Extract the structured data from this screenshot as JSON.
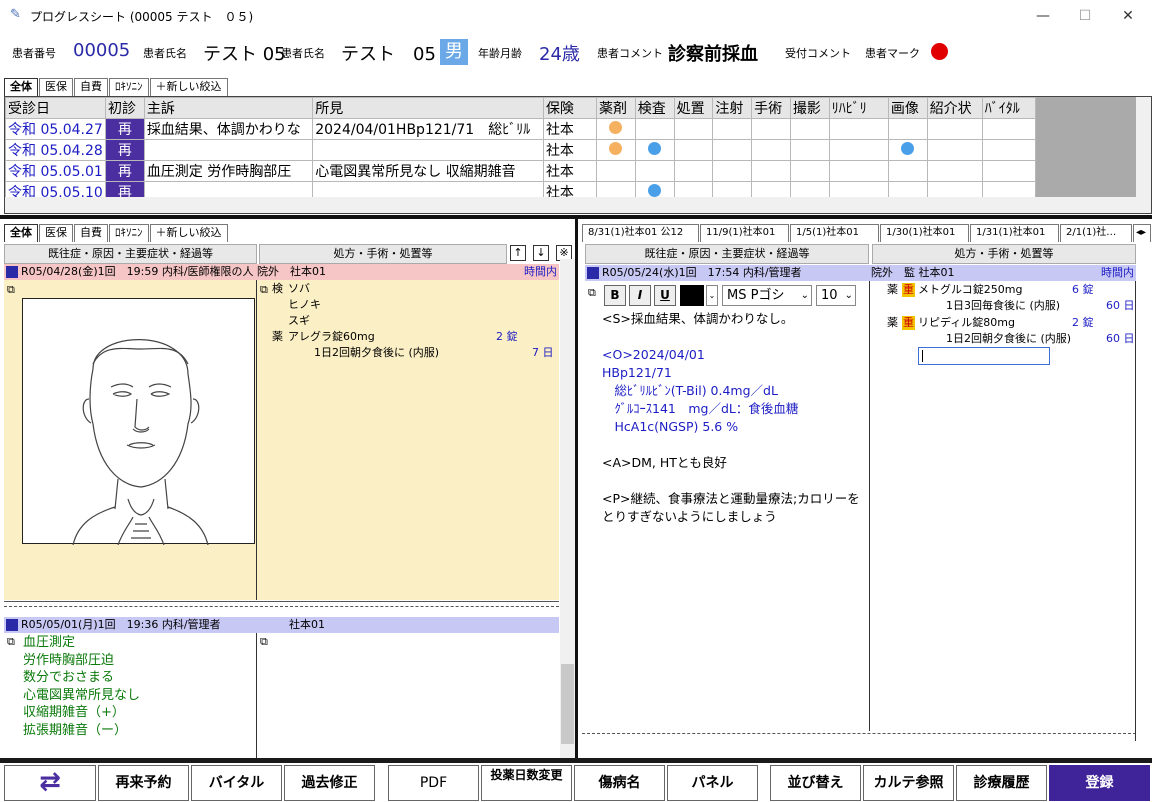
{
  "window": {
    "title": "プログレスシート (00005 テスト　０５)",
    "min": "—",
    "max": "☐",
    "close": "✕"
  },
  "patient": {
    "id_label": "患者番号",
    "id": "00005",
    "name_label": "患者氏名",
    "name": "テスト 05",
    "name2_label": "患者氏名",
    "name2": "テスト　05",
    "sex": "男",
    "age_label": "年齢月齢",
    "age": "24歳",
    "comment_label": "患者コメント",
    "comment": "診察前採血",
    "reception_label": "受付コメント",
    "mark_label": "患者マーク",
    "mark_color": "#e00000"
  },
  "top_tabs": [
    "全体",
    "医保",
    "自費",
    "ﾛｷｿﾆﾝ",
    "＋新しい絞込"
  ],
  "visits": {
    "headers": [
      "受診日",
      "初診",
      "主訴",
      "所見",
      "保険",
      "薬剤",
      "検査",
      "処置",
      "注射",
      "手術",
      "撮影",
      "ﾘﾊﾋﾞﾘ",
      "画像",
      "紹介状",
      "ﾊﾞｲﾀﾙ"
    ],
    "rows": [
      {
        "date": "令和 05.04.27",
        "type": "再",
        "complaint": "採血結果、体調かわりな",
        "finding": "2024/04/01HBp121/71　総ﾋﾞﾘﾙ",
        "ins": "社本",
        "drug": "#f5b060",
        "test": "",
        "image": ""
      },
      {
        "date": "令和 05.04.28",
        "type": "再",
        "complaint": "",
        "finding": "",
        "ins": "社本",
        "drug": "#f5b060",
        "test": "#4aa0e8",
        "image": "#4aa0e8"
      },
      {
        "date": "令和 05.05.01",
        "type": "再",
        "complaint": "血圧測定 労作時胸部圧",
        "finding": "心電図異常所見なし 収縮期雑音",
        "ins": "社本",
        "drug": "",
        "test": "",
        "image": ""
      },
      {
        "date": "令和 05.05.10",
        "type": "再",
        "complaint": "",
        "finding": "",
        "ins": "社本",
        "drug": "",
        "test": "#4aa0e8",
        "image": ""
      }
    ]
  },
  "left": {
    "tabs": [
      "全体",
      "医保",
      "自費",
      "ﾛｷｿﾆﾝ",
      "＋新しい絞込"
    ],
    "col1": "既往症・原因・主要症状・経過等",
    "col2": "処方・手術・処置等",
    "rec1": {
      "header": "R05/04/28(金)1回　19:59 内科/医師権限の人",
      "ins": "院外　社本01",
      "time": "時間内",
      "orders": [
        {
          "k": "検",
          "t": "ソバ"
        },
        {
          "k": "",
          "t": "ヒノキ"
        },
        {
          "k": "",
          "t": "スギ"
        },
        {
          "k": "薬",
          "t": "アレグラ錠60mg",
          "q": "2 錠"
        },
        {
          "k": "",
          "t": "1日2回朝夕食後に (内服)",
          "q": "7 日"
        }
      ]
    },
    "rec2": {
      "header": "R05/05/01(月)1回　19:36 内科/管理者",
      "ins": "社本01",
      "lines": [
        "血圧測定",
        "労作時胸部圧迫",
        "数分でおさまる",
        "心電図異常所見なし",
        "収縮期雑音（+）",
        "拡張期雑音（ー）"
      ]
    }
  },
  "right": {
    "tabs": [
      "8/31(1)社本01 公12",
      "11/9(1)社本01",
      "1/5(1)社本01",
      "1/30(1)社本01",
      "1/31(1)社本01",
      "2/1(1)社…"
    ],
    "col1": "既往症・原因・主要症状・経過等",
    "col2": "処方・手術・処置等",
    "header": "R05/05/24(水)1回　17:54 内科/管理者",
    "ins": "院外　監 社本01",
    "time": "時間内",
    "font": "MS Pゴシ",
    "size": "10",
    "soap": [
      "<S>採血結果、体調かわりなし。",
      "",
      "<O>2024/04/01",
      "HBp121/71",
      "　総ﾋﾞﾘﾙﾋﾞﾝ(T-Bil) 0.4mg／dL",
      "　ｸﾞﾙｺｰｽ141　mg／dL：食後血糖",
      "　HcA1c(NGSP) 5.6 %",
      "",
      "<A>DM, HTとも良好",
      "",
      "<P>継続、食事療法と運動量療法;カロリーを",
      "とりすぎないようにしましょう"
    ],
    "rx": [
      {
        "d": "メトグルコ錠250mg",
        "q": "6 錠",
        "u": "1日3回毎食後に (内服)",
        "days": "60 日"
      },
      {
        "d": "リピディル錠80mg",
        "q": "2 錠",
        "u": "1日2回朝夕食後に (内服)",
        "days": "60 日"
      }
    ],
    "rx_kind": "薬",
    "rx_tag": "重"
  },
  "bottom": [
    "⇄",
    "再来予約",
    "バイタル",
    "過去修正",
    "PDF",
    "投薬日数変更",
    "傷病名",
    "パネル",
    "並び替え",
    "カルテ参照",
    "診療履歴",
    "登録"
  ]
}
